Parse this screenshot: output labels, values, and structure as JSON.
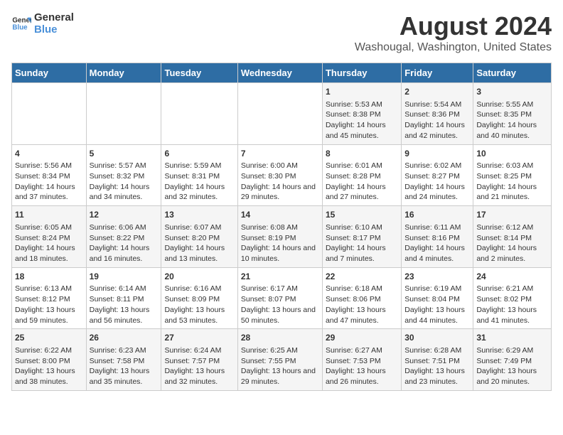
{
  "logo": {
    "line1": "General",
    "line2": "Blue"
  },
  "title": "August 2024",
  "subtitle": "Washougal, Washington, United States",
  "days_of_week": [
    "Sunday",
    "Monday",
    "Tuesday",
    "Wednesday",
    "Thursday",
    "Friday",
    "Saturday"
  ],
  "weeks": [
    [
      {
        "day": "",
        "content": ""
      },
      {
        "day": "",
        "content": ""
      },
      {
        "day": "",
        "content": ""
      },
      {
        "day": "",
        "content": ""
      },
      {
        "day": "1",
        "content": "Sunrise: 5:53 AM\nSunset: 8:38 PM\nDaylight: 14 hours and 45 minutes."
      },
      {
        "day": "2",
        "content": "Sunrise: 5:54 AM\nSunset: 8:36 PM\nDaylight: 14 hours and 42 minutes."
      },
      {
        "day": "3",
        "content": "Sunrise: 5:55 AM\nSunset: 8:35 PM\nDaylight: 14 hours and 40 minutes."
      }
    ],
    [
      {
        "day": "4",
        "content": "Sunrise: 5:56 AM\nSunset: 8:34 PM\nDaylight: 14 hours and 37 minutes."
      },
      {
        "day": "5",
        "content": "Sunrise: 5:57 AM\nSunset: 8:32 PM\nDaylight: 14 hours and 34 minutes."
      },
      {
        "day": "6",
        "content": "Sunrise: 5:59 AM\nSunset: 8:31 PM\nDaylight: 14 hours and 32 minutes."
      },
      {
        "day": "7",
        "content": "Sunrise: 6:00 AM\nSunset: 8:30 PM\nDaylight: 14 hours and 29 minutes."
      },
      {
        "day": "8",
        "content": "Sunrise: 6:01 AM\nSunset: 8:28 PM\nDaylight: 14 hours and 27 minutes."
      },
      {
        "day": "9",
        "content": "Sunrise: 6:02 AM\nSunset: 8:27 PM\nDaylight: 14 hours and 24 minutes."
      },
      {
        "day": "10",
        "content": "Sunrise: 6:03 AM\nSunset: 8:25 PM\nDaylight: 14 hours and 21 minutes."
      }
    ],
    [
      {
        "day": "11",
        "content": "Sunrise: 6:05 AM\nSunset: 8:24 PM\nDaylight: 14 hours and 18 minutes."
      },
      {
        "day": "12",
        "content": "Sunrise: 6:06 AM\nSunset: 8:22 PM\nDaylight: 14 hours and 16 minutes."
      },
      {
        "day": "13",
        "content": "Sunrise: 6:07 AM\nSunset: 8:20 PM\nDaylight: 14 hours and 13 minutes."
      },
      {
        "day": "14",
        "content": "Sunrise: 6:08 AM\nSunset: 8:19 PM\nDaylight: 14 hours and 10 minutes."
      },
      {
        "day": "15",
        "content": "Sunrise: 6:10 AM\nSunset: 8:17 PM\nDaylight: 14 hours and 7 minutes."
      },
      {
        "day": "16",
        "content": "Sunrise: 6:11 AM\nSunset: 8:16 PM\nDaylight: 14 hours and 4 minutes."
      },
      {
        "day": "17",
        "content": "Sunrise: 6:12 AM\nSunset: 8:14 PM\nDaylight: 14 hours and 2 minutes."
      }
    ],
    [
      {
        "day": "18",
        "content": "Sunrise: 6:13 AM\nSunset: 8:12 PM\nDaylight: 13 hours and 59 minutes."
      },
      {
        "day": "19",
        "content": "Sunrise: 6:14 AM\nSunset: 8:11 PM\nDaylight: 13 hours and 56 minutes."
      },
      {
        "day": "20",
        "content": "Sunrise: 6:16 AM\nSunset: 8:09 PM\nDaylight: 13 hours and 53 minutes."
      },
      {
        "day": "21",
        "content": "Sunrise: 6:17 AM\nSunset: 8:07 PM\nDaylight: 13 hours and 50 minutes."
      },
      {
        "day": "22",
        "content": "Sunrise: 6:18 AM\nSunset: 8:06 PM\nDaylight: 13 hours and 47 minutes."
      },
      {
        "day": "23",
        "content": "Sunrise: 6:19 AM\nSunset: 8:04 PM\nDaylight: 13 hours and 44 minutes."
      },
      {
        "day": "24",
        "content": "Sunrise: 6:21 AM\nSunset: 8:02 PM\nDaylight: 13 hours and 41 minutes."
      }
    ],
    [
      {
        "day": "25",
        "content": "Sunrise: 6:22 AM\nSunset: 8:00 PM\nDaylight: 13 hours and 38 minutes."
      },
      {
        "day": "26",
        "content": "Sunrise: 6:23 AM\nSunset: 7:58 PM\nDaylight: 13 hours and 35 minutes."
      },
      {
        "day": "27",
        "content": "Sunrise: 6:24 AM\nSunset: 7:57 PM\nDaylight: 13 hours and 32 minutes."
      },
      {
        "day": "28",
        "content": "Sunrise: 6:25 AM\nSunset: 7:55 PM\nDaylight: 13 hours and 29 minutes."
      },
      {
        "day": "29",
        "content": "Sunrise: 6:27 AM\nSunset: 7:53 PM\nDaylight: 13 hours and 26 minutes."
      },
      {
        "day": "30",
        "content": "Sunrise: 6:28 AM\nSunset: 7:51 PM\nDaylight: 13 hours and 23 minutes."
      },
      {
        "day": "31",
        "content": "Sunrise: 6:29 AM\nSunset: 7:49 PM\nDaylight: 13 hours and 20 minutes."
      }
    ]
  ]
}
